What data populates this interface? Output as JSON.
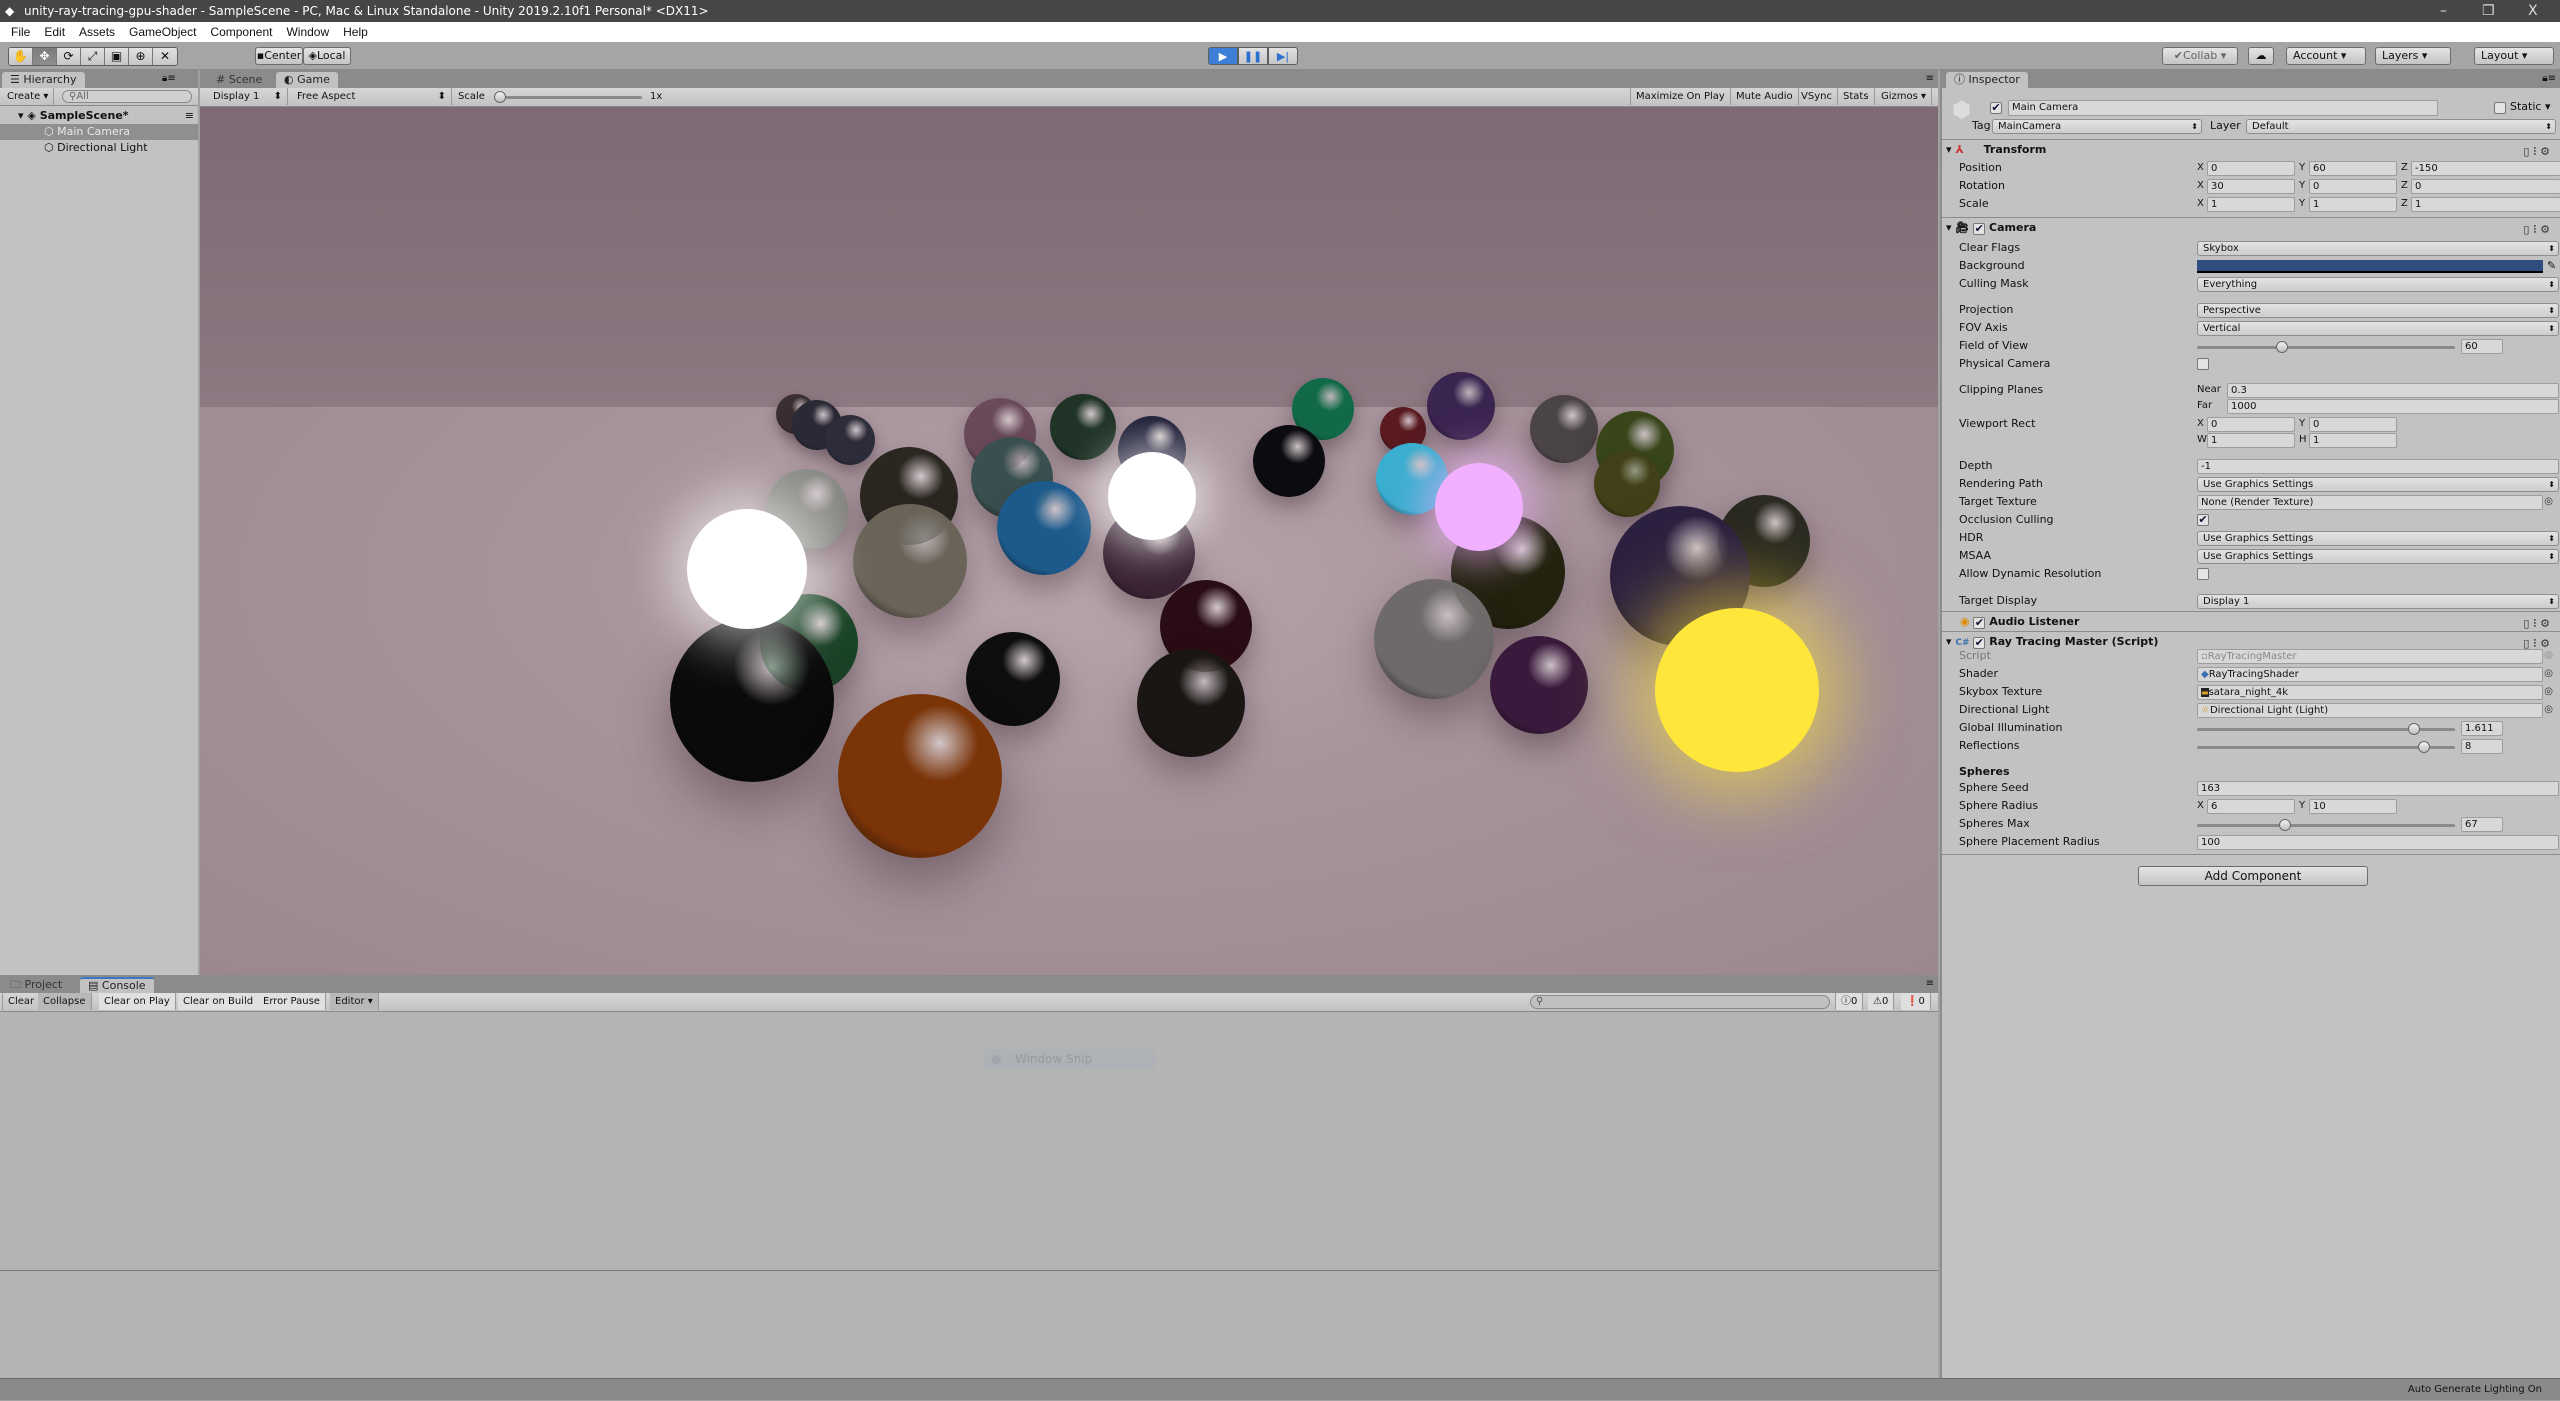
{
  "title": "unity-ray-tracing-gpu-shader - SampleScene - PC, Mac & Linux Standalone - Unity 2019.2.10f1 Personal* <DX11>",
  "window_controls": {
    "minimize": "–",
    "restore": "❐",
    "close": "X"
  },
  "menu": [
    "File",
    "Edit",
    "Assets",
    "GameObject",
    "Component",
    "Window",
    "Help"
  ],
  "toolbar": {
    "tools": [
      "hand-tool",
      "move-tool",
      "rotate-tool",
      "scale-tool",
      "rect-tool",
      "transform-tool",
      "custom-tool"
    ],
    "active_tool": "move-tool",
    "pivot": "Center",
    "space": "Local",
    "play_active": true,
    "collab": "Collab",
    "account": "Account",
    "layers": "Layers",
    "layout": "Layout"
  },
  "hierarchy": {
    "tab": "Hierarchy",
    "create": "Create",
    "search_placeholder": "All",
    "scene": "SampleScene*",
    "items": [
      "Main Camera",
      "Directional Light"
    ]
  },
  "game": {
    "tabs": [
      "Scene",
      "Game"
    ],
    "active_tab": "Game",
    "display": "Display 1",
    "aspect": "Free Aspect",
    "scale_label": "Scale",
    "scale_value": "1x",
    "buttons": [
      "Maximize On Play",
      "Mute Audio",
      "VSync",
      "Stats",
      "Gizmos"
    ]
  },
  "console": {
    "tabs": [
      "Project",
      "Console"
    ],
    "active_tab": "Console",
    "buttons": [
      "Clear",
      "Collapse",
      "Clear on Play",
      "Clear on Build",
      "Error Pause",
      "Editor"
    ],
    "info_count": "0",
    "warning_count": "0",
    "error_count": "0",
    "overlay": "Window Snip"
  },
  "inspector": {
    "tab": "Inspector",
    "object_name": "Main Camera",
    "active": true,
    "static_label": "Static",
    "tag_label": "Tag",
    "tag": "MainCamera",
    "layer_label": "Layer",
    "layer": "Default",
    "transform": {
      "title": "Transform",
      "position": {
        "label": "Position",
        "x": "0",
        "y": "60",
        "z": "-150"
      },
      "rotation": {
        "label": "Rotation",
        "x": "30",
        "y": "0",
        "z": "0"
      },
      "scale": {
        "label": "Scale",
        "x": "1",
        "y": "1",
        "z": "1"
      }
    },
    "camera": {
      "title": "Camera",
      "clear_flags": {
        "label": "Clear Flags",
        "value": "Skybox"
      },
      "background": {
        "label": "Background",
        "color": "#2f4d7e"
      },
      "culling_mask": {
        "label": "Culling Mask",
        "value": "Everything"
      },
      "projection": {
        "label": "Projection",
        "value": "Perspective"
      },
      "fov_axis": {
        "label": "FOV Axis",
        "value": "Vertical"
      },
      "fov": {
        "label": "Field of View",
        "value": "60",
        "fraction": 0.33
      },
      "physical_camera": {
        "label": "Physical Camera",
        "checked": false
      },
      "clipping": {
        "label": "Clipping Planes",
        "near_label": "Near",
        "near": "0.3",
        "far_label": "Far",
        "far": "1000"
      },
      "viewport": {
        "label": "Viewport Rect",
        "x": "0",
        "y": "0",
        "w": "1",
        "h": "1"
      },
      "depth": {
        "label": "Depth",
        "value": "-1"
      },
      "rendering_path": {
        "label": "Rendering Path",
        "value": "Use Graphics Settings"
      },
      "target_texture": {
        "label": "Target Texture",
        "value": "None (Render Texture)"
      },
      "occlusion": {
        "label": "Occlusion Culling",
        "checked": true
      },
      "hdr": {
        "label": "HDR",
        "value": "Use Graphics Settings"
      },
      "msaa": {
        "label": "MSAA",
        "value": "Use Graphics Settings"
      },
      "dynamic_resolution": {
        "label": "Allow Dynamic Resolution",
        "checked": false
      },
      "target_display": {
        "label": "Target Display",
        "value": "Display 1"
      }
    },
    "audio_listener": {
      "title": "Audio Listener"
    },
    "ray_tracing": {
      "title": "Ray Tracing Master (Script)",
      "script": {
        "label": "Script",
        "value": "RayTracingMaster"
      },
      "shader": {
        "label": "Shader",
        "value": "RayTracingShader"
      },
      "skybox": {
        "label": "Skybox Texture",
        "value": "satara_night_4k"
      },
      "light": {
        "label": "Directional Light",
        "value": "Directional Light (Light)"
      },
      "gi": {
        "label": "Global Illumination",
        "value": "1.611",
        "fraction": 0.84
      },
      "reflections": {
        "label": "Reflections",
        "value": "8",
        "fraction": 0.88
      },
      "spheres_header": "Spheres",
      "seed": {
        "label": "Sphere Seed",
        "value": "163"
      },
      "radius": {
        "label": "Sphere Radius",
        "x": "6",
        "y": "10"
      },
      "max": {
        "label": "Spheres Max",
        "value": "67",
        "fraction": 0.34
      },
      "placement": {
        "label": "Sphere Placement Radius",
        "value": "100"
      }
    },
    "add_component": "Add Component"
  },
  "status": "Auto Generate Lighting On"
}
